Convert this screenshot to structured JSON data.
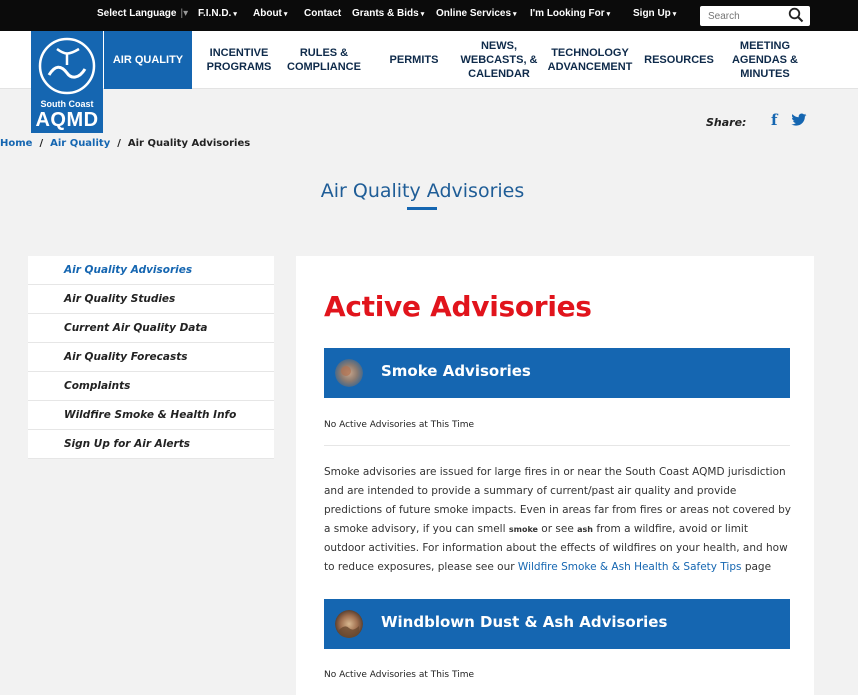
{
  "topbar": {
    "select_language": "Select Language",
    "items": [
      {
        "label": "F.I.N.D.",
        "caret": "▾"
      },
      {
        "label": "About",
        "caret": "▾"
      },
      {
        "label": "Contact",
        "caret": ""
      },
      {
        "label": "Grants & Bids",
        "caret": "▾"
      },
      {
        "label": "Online Services",
        "caret": "▾"
      },
      {
        "label": "I'm Looking For",
        "caret": "▾"
      },
      {
        "label": "Sign Up",
        "caret": "▾"
      }
    ],
    "search_placeholder": "Search"
  },
  "logo": {
    "line1": "South Coast",
    "line2": "AQMD"
  },
  "nav": [
    {
      "label": "AIR QUALITY",
      "active": true
    },
    {
      "label": "INCENTIVE\nPROGRAMS"
    },
    {
      "label": "RULES &\nCOMPLIANCE"
    },
    {
      "label": "PERMITS"
    },
    {
      "label": "NEWS,\nWEBCASTS, &\nCALENDAR"
    },
    {
      "label": "TECHNOLOGY\nADVANCEMENT"
    },
    {
      "label": "RESOURCES"
    },
    {
      "label": "MEETING\nAGENDAS &\nMINUTES"
    }
  ],
  "breadcrumb": {
    "home": "Home",
    "sep": "/",
    "level1": "Air Quality",
    "current": "Air Quality Advisories"
  },
  "share": {
    "label": "Share:"
  },
  "page_title": "Air Quality Advisories",
  "sidebar": [
    {
      "label": "Air Quality Advisories",
      "active": true
    },
    {
      "label": "Air Quality Studies"
    },
    {
      "label": "Current Air Quality Data"
    },
    {
      "label": "Air Quality Forecasts"
    },
    {
      "label": "Complaints"
    },
    {
      "label": "Wildfire Smoke & Health Info"
    },
    {
      "label": "Sign Up for Air Alerts"
    }
  ],
  "main": {
    "heading": "Active Advisories",
    "smoke": {
      "title": "Smoke Advisories",
      "status": "No Active Advisories at This Time"
    },
    "description": {
      "part1": "Smoke advisories are issued for large fires in or near the South Coast AQMD jurisdiction and are intended to provide a summary of current/past air quality and provide predictions of future smoke impacts. Even in areas far from fires or areas not covered by a smoke advisory, if you can smell ",
      "smoke_word": "smoke",
      "part2": " or see ",
      "ash_word": "ash",
      "part3": " from a wildfire, avoid or limit outdoor activities. For information about the effects of wildfires on your health, and how to reduce exposures, please see our ",
      "link": "Wildfire Smoke & Ash Health & Safety Tips",
      "part4": " page"
    },
    "dust": {
      "title": "Windblown Dust & Ash Advisories",
      "status": "No Active Advisories at This Time"
    }
  },
  "colors": {
    "brand_blue": "#1566b1",
    "alert_red": "#e1141c",
    "topbar_black": "#0b0b0b"
  }
}
